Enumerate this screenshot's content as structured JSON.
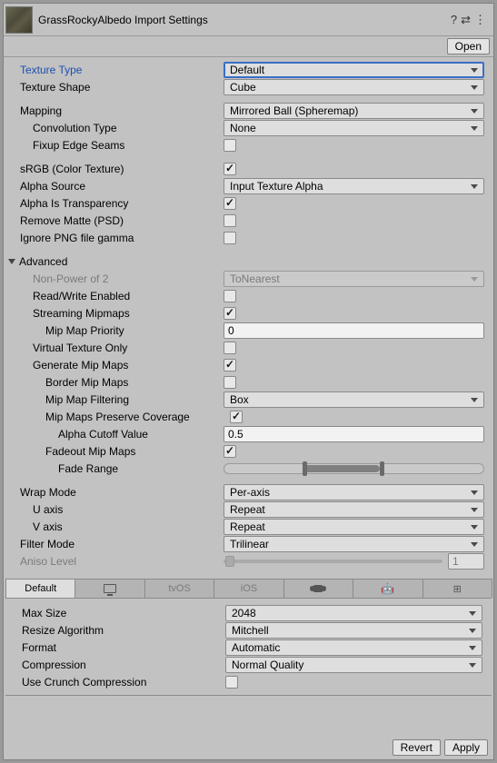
{
  "header": {
    "title": "GrassRockyAlbedo Import Settings",
    "open_label": "Open"
  },
  "texture_type": {
    "label": "Texture Type",
    "value": "Default"
  },
  "texture_shape": {
    "label": "Texture Shape",
    "value": "Cube"
  },
  "mapping": {
    "label": "Mapping",
    "value": "Mirrored Ball (Spheremap)"
  },
  "conv_type": {
    "label": "Convolution Type",
    "value": "None"
  },
  "fixup": {
    "label": "Fixup Edge Seams",
    "checked": false
  },
  "srgb": {
    "label": "sRGB (Color Texture)",
    "checked": true
  },
  "alpha_source": {
    "label": "Alpha Source",
    "value": "Input Texture Alpha"
  },
  "alpha_trans": {
    "label": "Alpha Is Transparency",
    "checked": true
  },
  "remove_matte": {
    "label": "Remove Matte (PSD)",
    "checked": false
  },
  "ignore_png": {
    "label": "Ignore PNG file gamma",
    "checked": false
  },
  "advanced": {
    "label": "Advanced"
  },
  "npo2": {
    "label": "Non-Power of 2",
    "value": "ToNearest"
  },
  "rw": {
    "label": "Read/Write Enabled",
    "checked": false
  },
  "stream_mip": {
    "label": "Streaming Mipmaps",
    "checked": true
  },
  "mip_prio": {
    "label": "Mip Map Priority",
    "value": "0"
  },
  "virt_tex": {
    "label": "Virtual Texture Only",
    "checked": false
  },
  "gen_mip": {
    "label": "Generate Mip Maps",
    "checked": true
  },
  "border_mip": {
    "label": "Border Mip Maps",
    "checked": false
  },
  "mip_filter": {
    "label": "Mip Map Filtering",
    "value": "Box"
  },
  "mip_preserve": {
    "label": "Mip Maps Preserve Coverage",
    "checked": true
  },
  "alpha_cut": {
    "label": "Alpha Cutoff Value",
    "value": "0.5"
  },
  "fadeout": {
    "label": "Fadeout Mip Maps",
    "checked": true
  },
  "fade_range": {
    "label": "Fade Range"
  },
  "wrap": {
    "label": "Wrap Mode",
    "value": "Per-axis"
  },
  "u_axis": {
    "label": "U axis",
    "value": "Repeat"
  },
  "v_axis": {
    "label": "V axis",
    "value": "Repeat"
  },
  "filter_mode": {
    "label": "Filter Mode",
    "value": "Trilinear"
  },
  "aniso": {
    "label": "Aniso Level",
    "value": "1"
  },
  "platform_tabs": {
    "default_label": "Default",
    "tvos_label": "tvOS",
    "ios_label": "iOS"
  },
  "max_size": {
    "label": "Max Size",
    "value": "2048"
  },
  "resize_algo": {
    "label": "Resize Algorithm",
    "value": "Mitchell"
  },
  "format": {
    "label": "Format",
    "value": "Automatic"
  },
  "compression": {
    "label": "Compression",
    "value": "Normal Quality"
  },
  "crunch": {
    "label": "Use Crunch Compression",
    "checked": false
  },
  "footer": {
    "revert": "Revert",
    "apply": "Apply"
  }
}
